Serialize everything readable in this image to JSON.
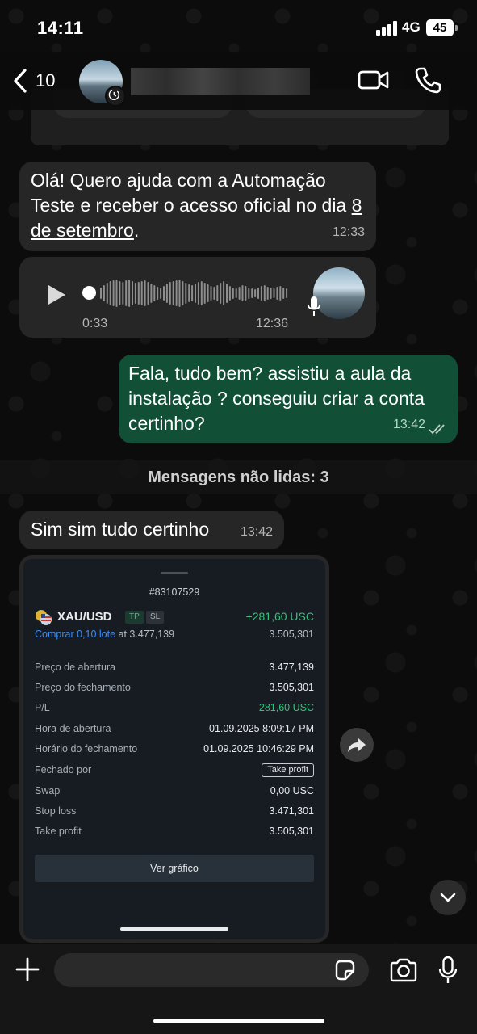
{
  "status_bar": {
    "time": "14:11",
    "network": "4G",
    "battery": "45"
  },
  "header": {
    "back_count": "10"
  },
  "messages": {
    "incoming_1": {
      "text_before": "Olá! Quero ajuda com a Automação Teste e receber o acesso oficial no dia ",
      "link_text": "8 de setembro",
      "text_after": ".",
      "time": "12:33"
    },
    "voice": {
      "duration": "0:33",
      "time": "12:36"
    },
    "outgoing_1": {
      "text": "Fala, tudo bem? assistiu a aula da instalação ? conseguiu criar a conta certinho?",
      "time": "13:42"
    },
    "unread_label": "Mensagens não lidas: 3",
    "incoming_2": {
      "text": "Sim sim tudo certinho",
      "time": "13:42"
    }
  },
  "trade_screenshot": {
    "order_id": "#83107529",
    "symbol": "XAU/USD",
    "tags": [
      "TP",
      "SL"
    ],
    "profit": "+281,60 USC",
    "action": "Comprar 0,10 lote",
    "action_suffix": " at 3.477,139",
    "current_price": "3.505,301",
    "details": [
      {
        "label": "Preço de abertura",
        "value": "3.477,139"
      },
      {
        "label": "Preço do fechamento",
        "value": "3.505,301"
      },
      {
        "label": "P/L",
        "value": "281,60 USC"
      },
      {
        "label": "Hora de abertura",
        "value": "01.09.2025 8:09:17 PM"
      },
      {
        "label": "Horário do fechamento",
        "value": "01.09.2025 10:46:29 PM"
      },
      {
        "label": "Fechado por",
        "value": "Take profit"
      },
      {
        "label": "Swap",
        "value": "0,00 USC"
      },
      {
        "label": "Stop loss",
        "value": "3.471,301"
      },
      {
        "label": "Take profit",
        "value": "3.505,301"
      }
    ],
    "chart_button": "Ver gráfico"
  },
  "input": {
    "placeholder": ""
  },
  "colors": {
    "outgoing_bubble": "#114f37",
    "incoming_bubble": "#262626",
    "profit_green": "#34c37a",
    "link_blue": "#3d8cf0"
  }
}
